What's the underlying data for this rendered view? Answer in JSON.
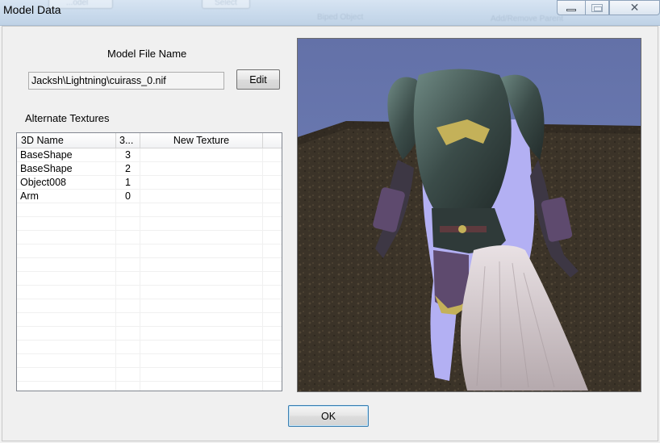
{
  "window": {
    "title": "Model Data",
    "controls": {
      "minimize_icon": "minimize-icon",
      "maximize_icon": "maximize-icon",
      "close_icon": "close-icon"
    }
  },
  "background_ghost": {
    "left_button": "...odel",
    "select_button": "Select",
    "object_label": "Biped Object",
    "addons_label": "Add/Remove Parent"
  },
  "model": {
    "label": "Model File Name",
    "file_name": "Jacksh\\Lightning\\cuirass_0.nif",
    "edit_label": "Edit"
  },
  "alt_textures": {
    "label": "Alternate Textures",
    "columns": [
      "3D Name",
      "3...",
      "New Texture",
      ""
    ],
    "rows": [
      {
        "name": "BaseShape",
        "index": "3",
        "texture": ""
      },
      {
        "name": "BaseShape",
        "index": "2",
        "texture": ""
      },
      {
        "name": "Object008",
        "index": "1",
        "texture": ""
      },
      {
        "name": "Arm",
        "index": "0",
        "texture": ""
      }
    ]
  },
  "preview": {
    "description_icon": "armor-model-preview"
  },
  "footer": {
    "ok_label": "OK"
  }
}
